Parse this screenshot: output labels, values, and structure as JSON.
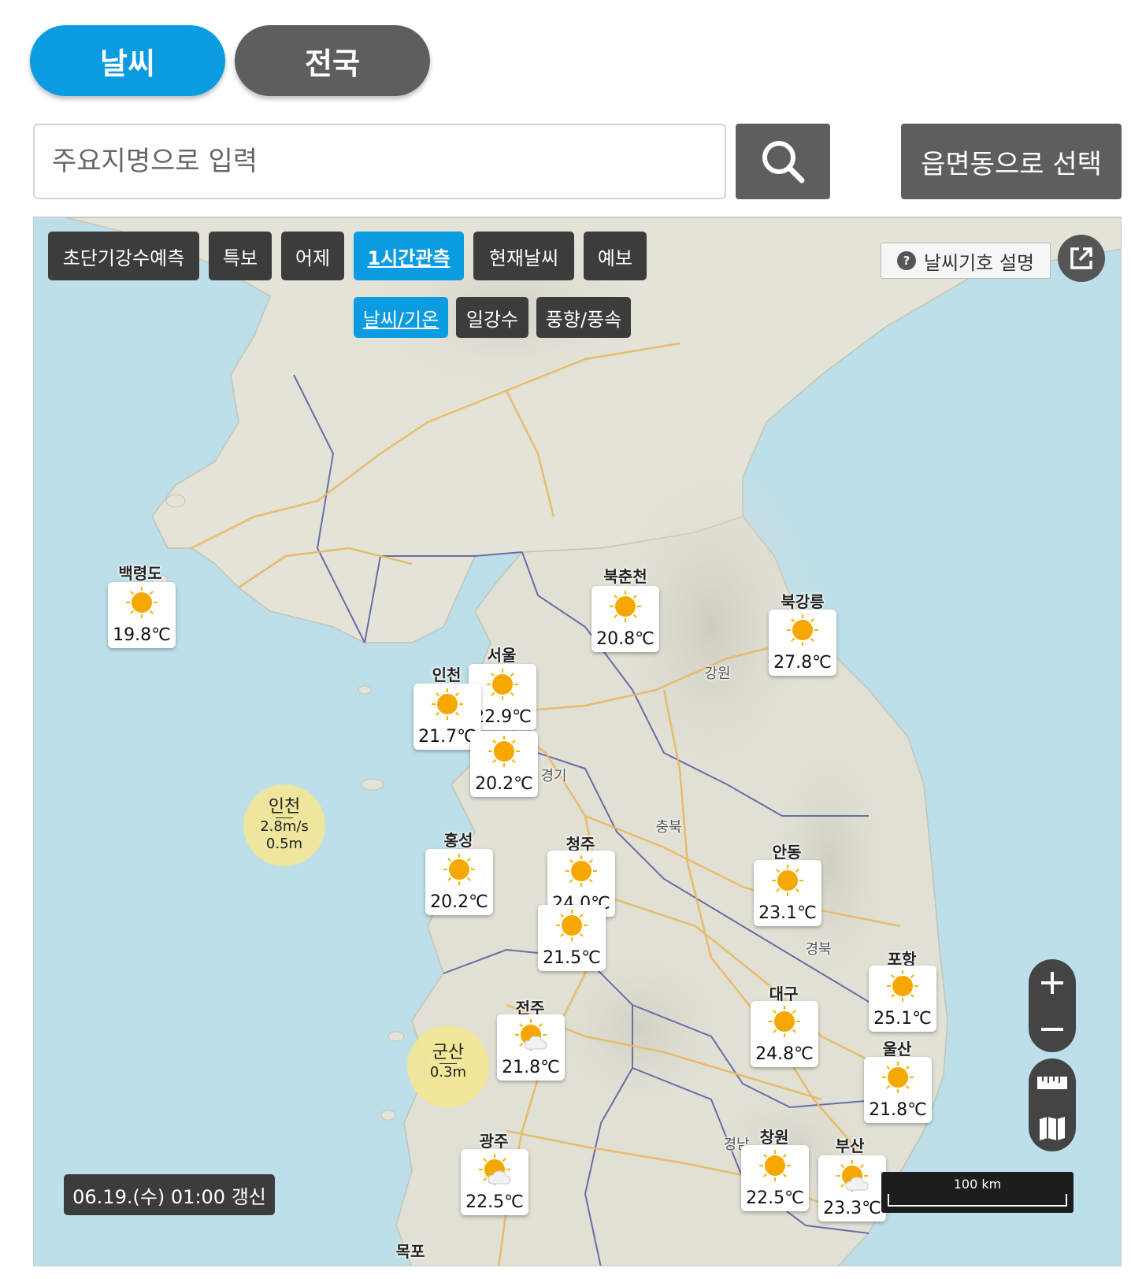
{
  "tabs": {
    "weather": "날씨",
    "nation": "전국"
  },
  "search": {
    "placeholder": "주요지명으로 입력",
    "emd_label": "읍면동으로 선택"
  },
  "map_tabs": [
    {
      "label": "초단기강수예측",
      "active": false
    },
    {
      "label": "특보",
      "active": false
    },
    {
      "label": "어제",
      "active": false
    },
    {
      "label": "1시간관측",
      "active": true
    },
    {
      "label": "현재날씨",
      "active": false
    },
    {
      "label": "예보",
      "active": false
    }
  ],
  "sub_tabs": [
    {
      "label": "날씨/기온",
      "active": true
    },
    {
      "label": "일강수",
      "active": false
    },
    {
      "label": "풍향/풍속",
      "active": false
    }
  ],
  "legend_help": "날씨기호 설명",
  "stations": [
    {
      "name": "백령도",
      "temp": "19.8℃",
      "icon": "sun-icon"
    },
    {
      "name": "북춘천",
      "temp": "20.8℃",
      "icon": "sun-icon"
    },
    {
      "name": "북강릉",
      "temp": "27.8℃",
      "icon": "sun-icon"
    },
    {
      "name": "서울",
      "temp": "22.9℃",
      "icon": "sun-icon"
    },
    {
      "name": "인천",
      "temp": "21.7℃",
      "icon": "sun-icon"
    },
    {
      "name": "",
      "temp": "20.2℃",
      "icon": "sun-icon"
    },
    {
      "name": "홍성",
      "temp": "20.2℃",
      "icon": "sun-icon"
    },
    {
      "name": "청주",
      "temp": "24.0℃",
      "icon": "sun-icon"
    },
    {
      "name": "",
      "temp": "21.5℃",
      "icon": "sun-icon"
    },
    {
      "name": "안동",
      "temp": "23.1℃",
      "icon": "sun-icon"
    },
    {
      "name": "포항",
      "temp": "25.1℃",
      "icon": "sun-icon"
    },
    {
      "name": "대구",
      "temp": "24.8℃",
      "icon": "sun-icon"
    },
    {
      "name": "전주",
      "temp": "21.8℃",
      "icon": "sun-cloud-icon"
    },
    {
      "name": "울산",
      "temp": "21.8℃",
      "icon": "sun-icon"
    },
    {
      "name": "광주",
      "temp": "22.5℃",
      "icon": "sun-cloud-icon"
    },
    {
      "name": "창원",
      "temp": "22.5℃",
      "icon": "sun-icon"
    },
    {
      "name": "부산",
      "temp": "23.3℃",
      "icon": "sun-cloud-icon"
    }
  ],
  "buoys": [
    {
      "name": "인천",
      "wind": "2.8m/s",
      "wave": "0.5m"
    },
    {
      "name": "군산",
      "wind": "",
      "wave": "0.3m"
    }
  ],
  "region_labels": [
    "강원",
    "경기",
    "충북",
    "경북",
    "경남",
    "목포"
  ],
  "timestamp": "06.19.(수) 01:00 갱신",
  "scale": "100 km",
  "colors": {
    "accent": "#0a9be0",
    "dark_button": "#5e5e5e",
    "sea": "#bcdfe9",
    "land": "#e3e3d8"
  }
}
